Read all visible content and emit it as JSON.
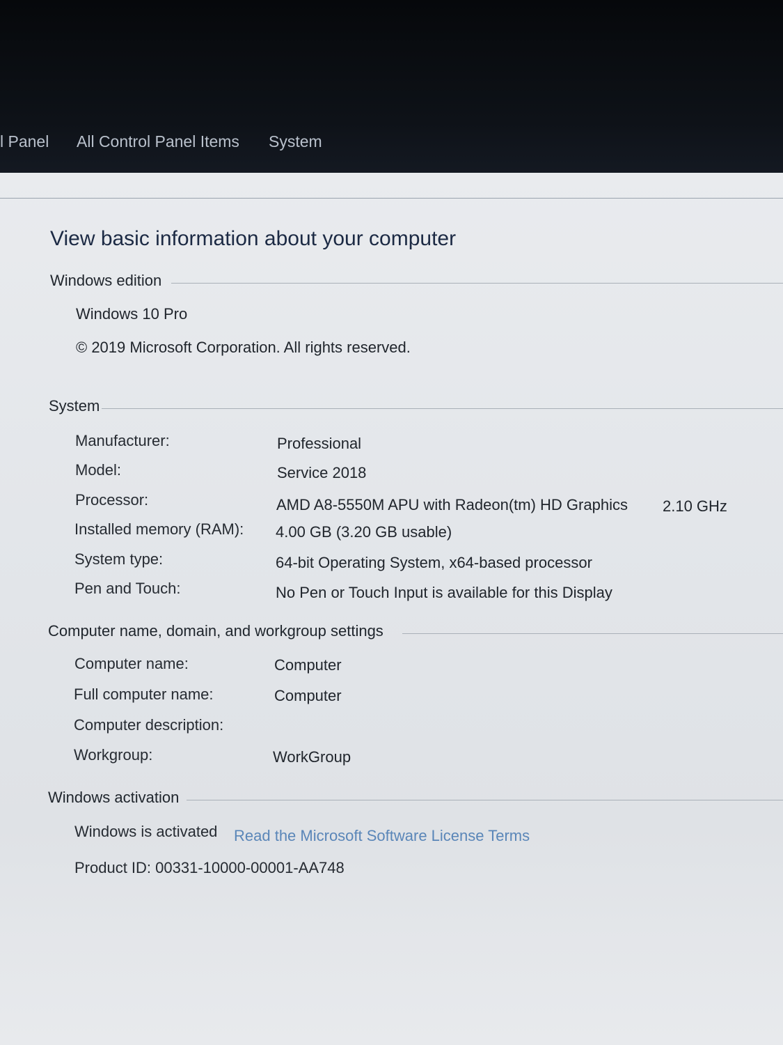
{
  "breadcrumb": [
    "l Panel",
    "All Control Panel Items",
    "System"
  ],
  "heading": "View basic information about your computer",
  "windows_edition": {
    "title": "Windows edition",
    "edition": "Windows 10 Pro",
    "copyright": "© 2019 Microsoft Corporation. All rights reserved."
  },
  "system": {
    "title": "System",
    "rows": [
      {
        "label": "Manufacturer:",
        "value": "Professional"
      },
      {
        "label": "Model:",
        "value": "Service 2018"
      },
      {
        "label": "Processor:",
        "value": "AMD A8-5550M APU with Radeon(tm) HD Graphics",
        "extra": "2.10 GHz"
      },
      {
        "label": "Installed memory (RAM):",
        "value": "4.00 GB (3.20 GB usable)"
      },
      {
        "label": "System type:",
        "value": "64-bit Operating System, x64-based processor"
      },
      {
        "label": "Pen and Touch:",
        "value": "No Pen or Touch Input is available for this Display"
      }
    ]
  },
  "computer_name": {
    "title": "Computer name, domain, and workgroup settings",
    "rows": [
      {
        "label": "Computer name:",
        "value": "Computer"
      },
      {
        "label": "Full computer name:",
        "value": "Computer"
      },
      {
        "label": "Computer description:",
        "value": ""
      },
      {
        "label": "Workgroup:",
        "value": "WorkGroup"
      }
    ]
  },
  "activation": {
    "title": "Windows activation",
    "status": "Windows is activated",
    "license_link": "Read the Microsoft Software License Terms",
    "product_id": "Product ID: 00331-10000-00001-AA748"
  }
}
